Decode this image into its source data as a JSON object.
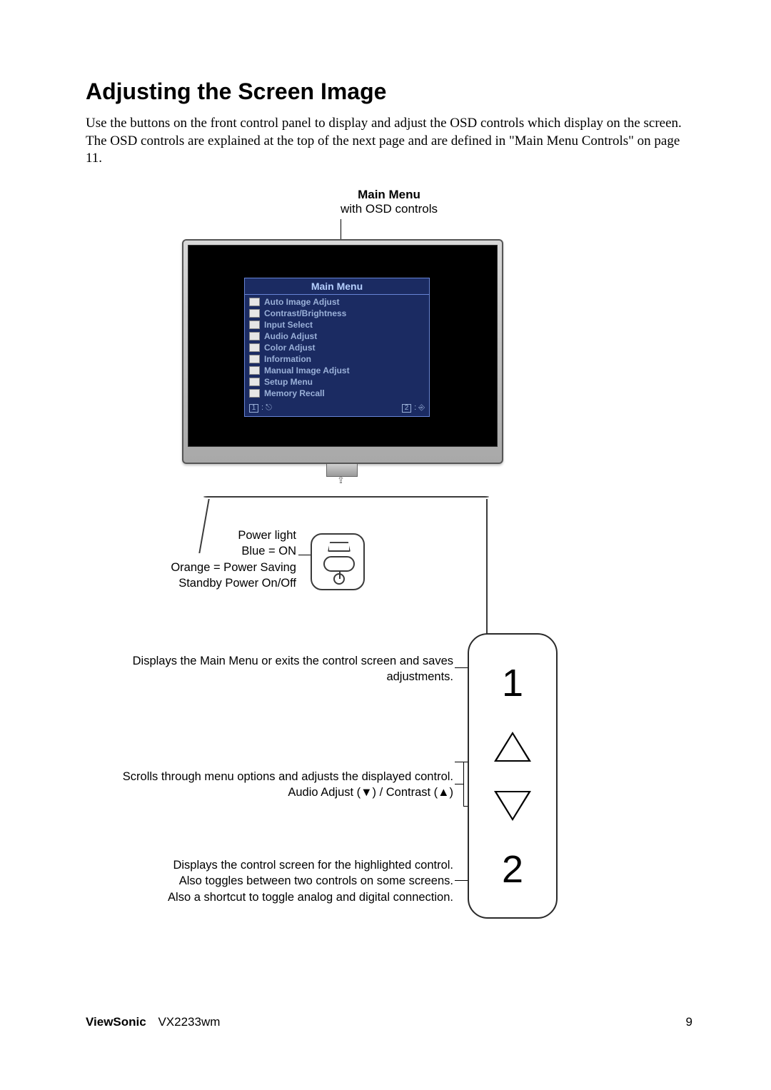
{
  "heading": "Adjusting the Screen Image",
  "intro": "Use the buttons on the front control panel to display and adjust the OSD controls which display on the screen. The OSD controls are explained at the top of the next page and are defined in \"Main Menu Controls\" on page 11.",
  "figure": {
    "title": "Main Menu",
    "subtitle": "with OSD controls"
  },
  "osd": {
    "title": "Main Menu",
    "items": [
      "Auto Image Adjust",
      "Contrast/Brightness",
      "Input Select",
      "Audio Adjust",
      "Color Adjust",
      "Information",
      "Manual Image Adjust",
      "Setup Menu",
      "Memory Recall"
    ],
    "footer_keys": {
      "left": "1",
      "right": "2"
    }
  },
  "callouts": {
    "power": {
      "l1": "Power light",
      "l2": "Blue = ON",
      "l3": "Orange = Power Saving",
      "l4": "Standby Power On/Off"
    },
    "btn1": {
      "l1": "Displays the Main Menu or exits the control screen and saves",
      "l2": "adjustments."
    },
    "scroll": {
      "l1": "Scrolls through menu options and adjusts the displayed control.",
      "l2": "Audio Adjust (▼) / Contrast  (▲)"
    },
    "btn2": {
      "l1": "Displays the control screen for the highlighted control.",
      "l2": "Also toggles between two controls on some screens.",
      "l3": "Also a shortcut to toggle analog and digital connection."
    }
  },
  "controls": {
    "one": "1",
    "two": "2"
  },
  "footer": {
    "brand": "ViewSonic",
    "model": "VX2233wm",
    "page": "9"
  }
}
